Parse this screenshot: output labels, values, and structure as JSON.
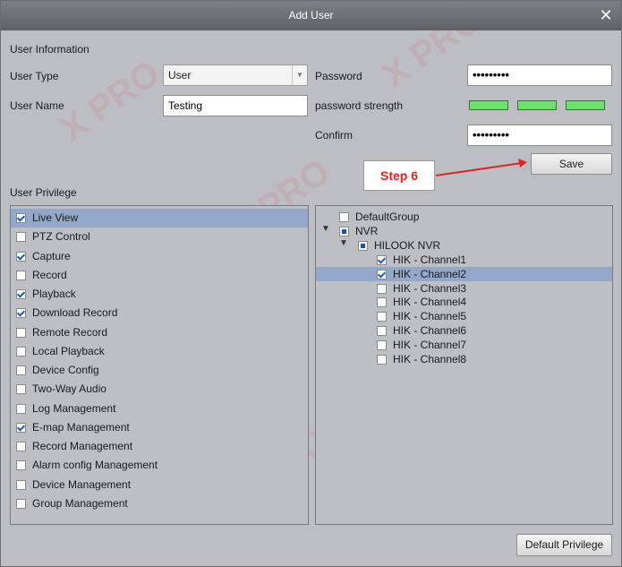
{
  "window": {
    "title": "Add User"
  },
  "user_info": {
    "section_label": "User Information",
    "user_type_label": "User Type",
    "user_type_value": "User",
    "user_name_label": "User Name",
    "user_name_value": "Testing",
    "password_label": "Password",
    "password_value": "•••••••••",
    "strength_label": "password strength",
    "confirm_label": "Confirm",
    "confirm_value": "•••••••••",
    "save_label": "Save"
  },
  "callout": {
    "text": "Step 6",
    "color": "#e22323"
  },
  "privilege": {
    "section_label": "User Privilege",
    "items": [
      {
        "label": "Live View",
        "checked": true
      },
      {
        "label": "PTZ Control",
        "checked": false
      },
      {
        "label": "Capture",
        "checked": true
      },
      {
        "label": "Record",
        "checked": false
      },
      {
        "label": "Playback",
        "checked": true
      },
      {
        "label": "Download Record",
        "checked": true
      },
      {
        "label": "Remote Record",
        "checked": false
      },
      {
        "label": "Local Playback",
        "checked": false
      },
      {
        "label": "Device Config",
        "checked": false
      },
      {
        "label": "Two-Way Audio",
        "checked": false
      },
      {
        "label": "Log Management",
        "checked": false
      },
      {
        "label": "E-map Management",
        "checked": true
      },
      {
        "label": "Record Management",
        "checked": false
      },
      {
        "label": "Alarm config Management",
        "checked": false
      },
      {
        "label": "Device Management",
        "checked": false
      },
      {
        "label": "Group Management",
        "checked": false
      }
    ]
  },
  "tree": {
    "items": [
      {
        "label": "DefaultGroup",
        "state": "unchecked"
      },
      {
        "label": "NVR",
        "state": "partial"
      },
      {
        "label": "HILOOK NVR",
        "state": "partial"
      },
      {
        "label": "HIK - Channel1",
        "state": "checked"
      },
      {
        "label": "HIK - Channel2",
        "state": "checked"
      },
      {
        "label": "HIK - Channel3",
        "state": "unchecked"
      },
      {
        "label": "HIK - Channel4",
        "state": "unchecked"
      },
      {
        "label": "HIK - Channel5",
        "state": "unchecked"
      },
      {
        "label": "HIK - Channel6",
        "state": "unchecked"
      },
      {
        "label": "HIK - Channel7",
        "state": "unchecked"
      },
      {
        "label": "HIK - Channel8",
        "state": "unchecked"
      }
    ]
  },
  "footer": {
    "default_privilege_label": "Default Privilege"
  },
  "colors": {
    "strength_bar": "#6de16b",
    "selection": "#93a8c8",
    "title_bar": "#6e7075"
  }
}
